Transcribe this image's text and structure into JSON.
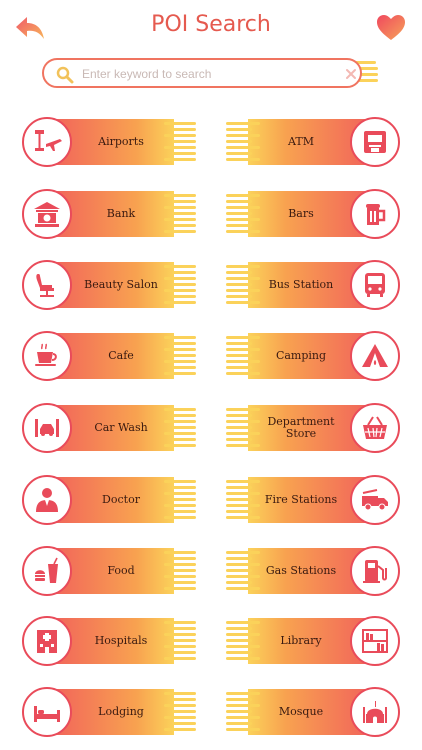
{
  "header": {
    "title": "POI Search"
  },
  "search": {
    "placeholder": "Enter keyword to search",
    "value": ""
  },
  "categories": [
    {
      "label": "Airports",
      "icon": "airport-icon"
    },
    {
      "label": "ATM",
      "icon": "atm-icon"
    },
    {
      "label": "Bank",
      "icon": "bank-icon"
    },
    {
      "label": "Bars",
      "icon": "beer-mug-icon"
    },
    {
      "label": "Beauty Salon",
      "icon": "salon-chair-icon"
    },
    {
      "label": "Bus Station",
      "icon": "bus-icon"
    },
    {
      "label": "Cafe",
      "icon": "coffee-cup-icon"
    },
    {
      "label": "Camping",
      "icon": "tent-icon"
    },
    {
      "label": "Car Wash",
      "icon": "car-wash-icon"
    },
    {
      "label": "Department Store",
      "icon": "basket-icon"
    },
    {
      "label": "Doctor",
      "icon": "doctor-icon"
    },
    {
      "label": "Fire Stations",
      "icon": "fire-truck-icon"
    },
    {
      "label": "Food",
      "icon": "fast-food-icon"
    },
    {
      "label": "Gas Stations",
      "icon": "gas-pump-icon"
    },
    {
      "label": "Hospitals",
      "icon": "hospital-icon"
    },
    {
      "label": "Library",
      "icon": "bookshelf-icon"
    },
    {
      "label": "Lodging",
      "icon": "bed-icon"
    },
    {
      "label": "Mosque",
      "icon": "mosque-icon"
    }
  ],
  "colors": {
    "accent": "#e94b5a",
    "gradient_start": "#ef4f5e",
    "gradient_end": "#fbd25a",
    "title": "#e55a4f"
  }
}
